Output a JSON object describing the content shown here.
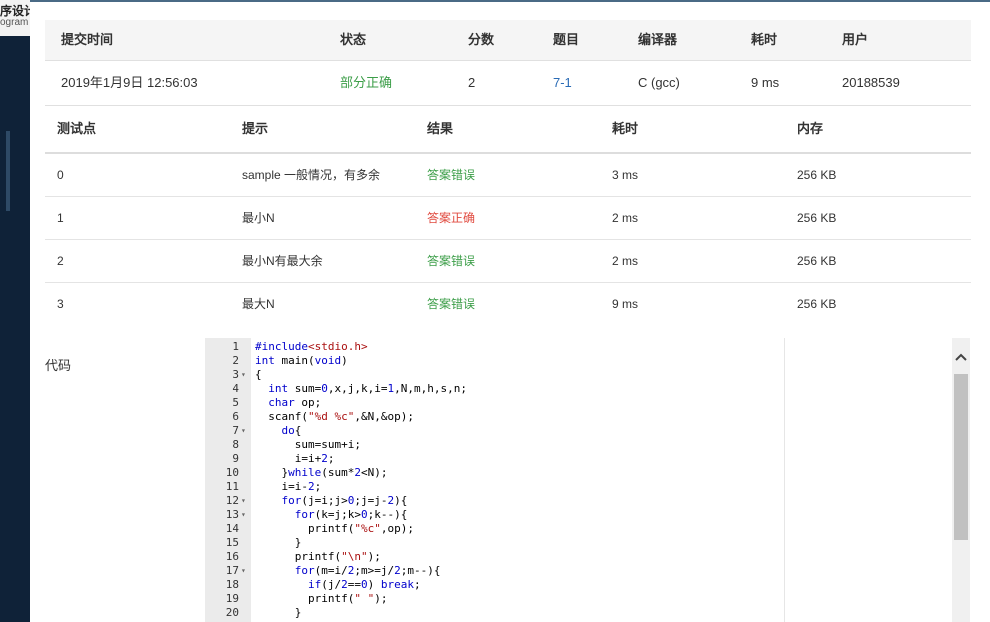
{
  "background_app": {
    "title_line1": "序设计",
    "title_line2": "ogram"
  },
  "submission": {
    "headers": [
      "提交时间",
      "状态",
      "分数",
      "题目",
      "编译器",
      "耗时",
      "用户"
    ],
    "row": {
      "time": "2019年1月9日 12:56:03",
      "status": "部分正确",
      "score": "2",
      "problem": "7-1",
      "compiler": "C (gcc)",
      "duration": "9 ms",
      "user": "20188539"
    }
  },
  "tests": {
    "headers": [
      "测试点",
      "提示",
      "结果",
      "耗时",
      "内存"
    ],
    "rows": [
      {
        "id": "0",
        "hint": "sample 一般情况，有多余",
        "result": "答案错误",
        "time": "3 ms",
        "memory": "256 KB"
      },
      {
        "id": "1",
        "hint": "最小N",
        "result": "答案正确",
        "time": "2 ms",
        "memory": "256 KB"
      },
      {
        "id": "2",
        "hint": "最小N有最大余",
        "result": "答案错误",
        "time": "2 ms",
        "memory": "256 KB"
      },
      {
        "id": "3",
        "hint": "最大N",
        "result": "答案错误",
        "time": "9 ms",
        "memory": "256 KB"
      }
    ]
  },
  "code": {
    "label": "代码",
    "lines": [
      "#include<stdio.h>",
      "int main(void)",
      "{",
      "  int sum=0,x,j,k,i=1,N,m,h,s,n;",
      "  char op;",
      "  scanf(\"%d %c\",&N,&op);",
      "    do{",
      "      sum=sum+i;",
      "      i=i+2;",
      "    }while(sum*2<N);",
      "    i=i-2;",
      "    for(j=i;j>0;j=j-2){",
      "      for(k=j;k>0;k--){",
      "        printf(\"%c\",op);",
      "      }",
      "      printf(\"\\n\");",
      "      for(m=i/2;m>=j/2;m--){",
      "        if(j/2==0) break;",
      "        printf(\" \");",
      "      }"
    ],
    "line_numbers": [
      "1",
      "2",
      "3",
      "4",
      "5",
      "6",
      "7",
      "8",
      "9",
      "10",
      "11",
      "12",
      "13",
      "14",
      "15",
      "16",
      "17",
      "18",
      "19",
      "20"
    ],
    "fold_markers": [
      "",
      "",
      "▾",
      "",
      "",
      "",
      "▾",
      "",
      "",
      "",
      "",
      "▾",
      "▾",
      "",
      "",
      "",
      "▾",
      "",
      "",
      ""
    ]
  },
  "icons": {
    "scroll_up": "chevron-up-icon",
    "fold": "fold-triangle-icon"
  },
  "colors": {
    "status_partial": "#3c9e48",
    "result_wrong": "#3c9e48",
    "result_correct": "#e04a3f",
    "problem_link": "#2a6bb5"
  }
}
